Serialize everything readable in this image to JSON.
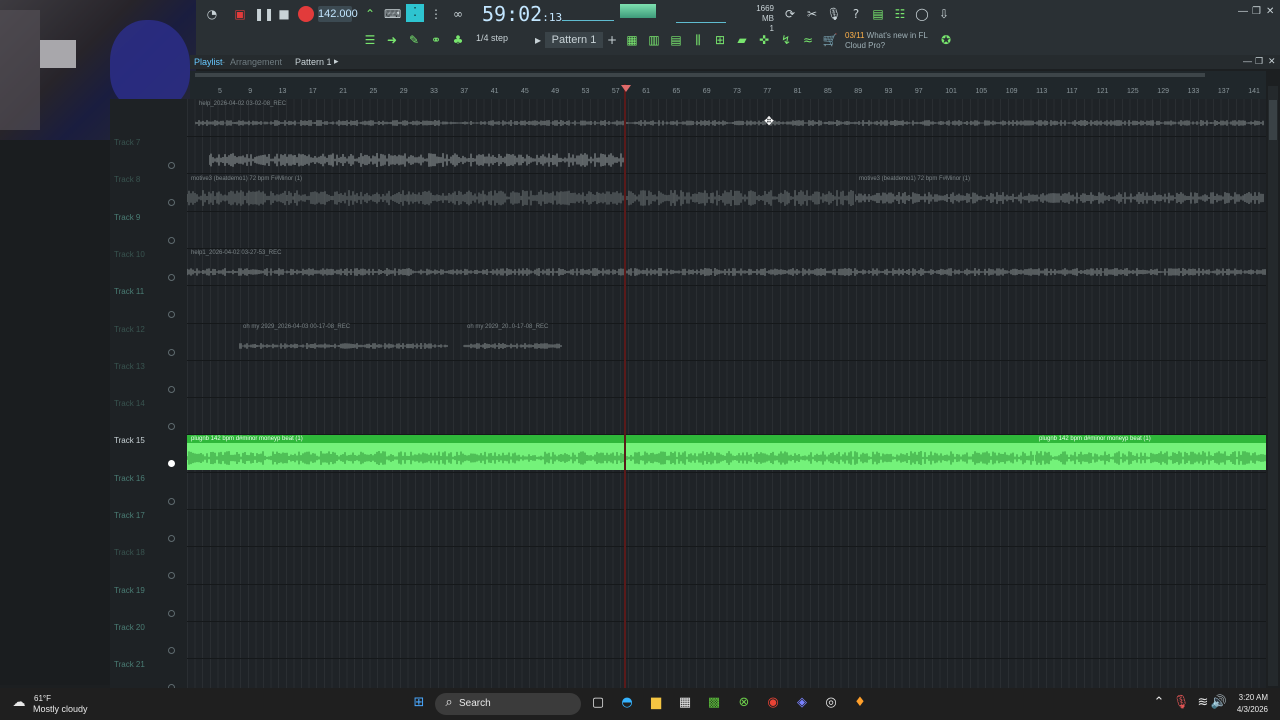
{
  "toolbar": {
    "bpm": "142.000",
    "time_main": "59:02",
    "time_sub": ":13",
    "mem_top": "1669 MB",
    "mem_bottom": "1",
    "step_label": "1/4 step",
    "pattern": "Pattern 1",
    "news_date": "03/11",
    "news_text_1": "What's new in FL",
    "news_text_2": "Cloud Pro?"
  },
  "playlist": {
    "title": "Playlist",
    "separator": "-",
    "arrangement": "Arrangement",
    "pattern": "Pattern 1",
    "ruler": [
      "5",
      "9",
      "13",
      "17",
      "21",
      "25",
      "29",
      "33",
      "37",
      "41",
      "45",
      "49",
      "53",
      "57",
      "61",
      "65",
      "69",
      "73",
      "77",
      "81",
      "85",
      "89",
      "93",
      "97",
      "101",
      "105",
      "109",
      "113",
      "117",
      "121",
      "125",
      "129",
      "133",
      "137",
      "141"
    ]
  },
  "tracks": [
    {
      "name": "Track 7",
      "style": "dim"
    },
    {
      "name": "Track 8",
      "style": "dim"
    },
    {
      "name": "Track 9",
      "style": "normal"
    },
    {
      "name": "Track 10",
      "style": "dim"
    },
    {
      "name": "Track 11",
      "style": "normal"
    },
    {
      "name": "Track 12",
      "style": "dim"
    },
    {
      "name": "Track 13",
      "style": "dim"
    },
    {
      "name": "Track 14",
      "style": "dim"
    },
    {
      "name": "Track 15",
      "style": "selected"
    },
    {
      "name": "Track 16",
      "style": "normal"
    },
    {
      "name": "Track 17",
      "style": "normal"
    },
    {
      "name": "Track 18",
      "style": "dim"
    },
    {
      "name": "Track 19",
      "style": "normal"
    },
    {
      "name": "Track 20",
      "style": "normal"
    },
    {
      "name": "Track 21",
      "style": "normal"
    }
  ],
  "clips": {
    "help_top": "help_2026-04-02 03-02-08_REC",
    "motive_a": "motive3 (beatdemo1) 72 bpm F#Minor (1)",
    "motive_b": "motive3 (beatdemo1) 72 bpm F#Minor (1)",
    "help1": "help1_2026-04-02 03-27-53_REC",
    "ohmy_a": "oh my 2929_2026-04-03 00-17-08_REC",
    "ohmy_b": "oh my 2929_20..0-17-08_REC",
    "plugnb_a": "plugnb 142 bpm d#minor moneyp beat (1)",
    "plugnb_b": "plugnb 142 bpm d#minor moneyp beat (1)"
  },
  "taskbar": {
    "temp": "61°F",
    "weather": "Mostly cloudy",
    "search": "Search",
    "time": "3:20 AM",
    "date": "4/3/2026"
  },
  "colors": {
    "toolbar_bg": "#2a3034",
    "clip_green": "#74f27a",
    "clip_green_header": "#2fb83a",
    "waveform_gray": "#8c9496",
    "playhead": "#e06b6b",
    "accent_blue": "#67c9ff"
  }
}
